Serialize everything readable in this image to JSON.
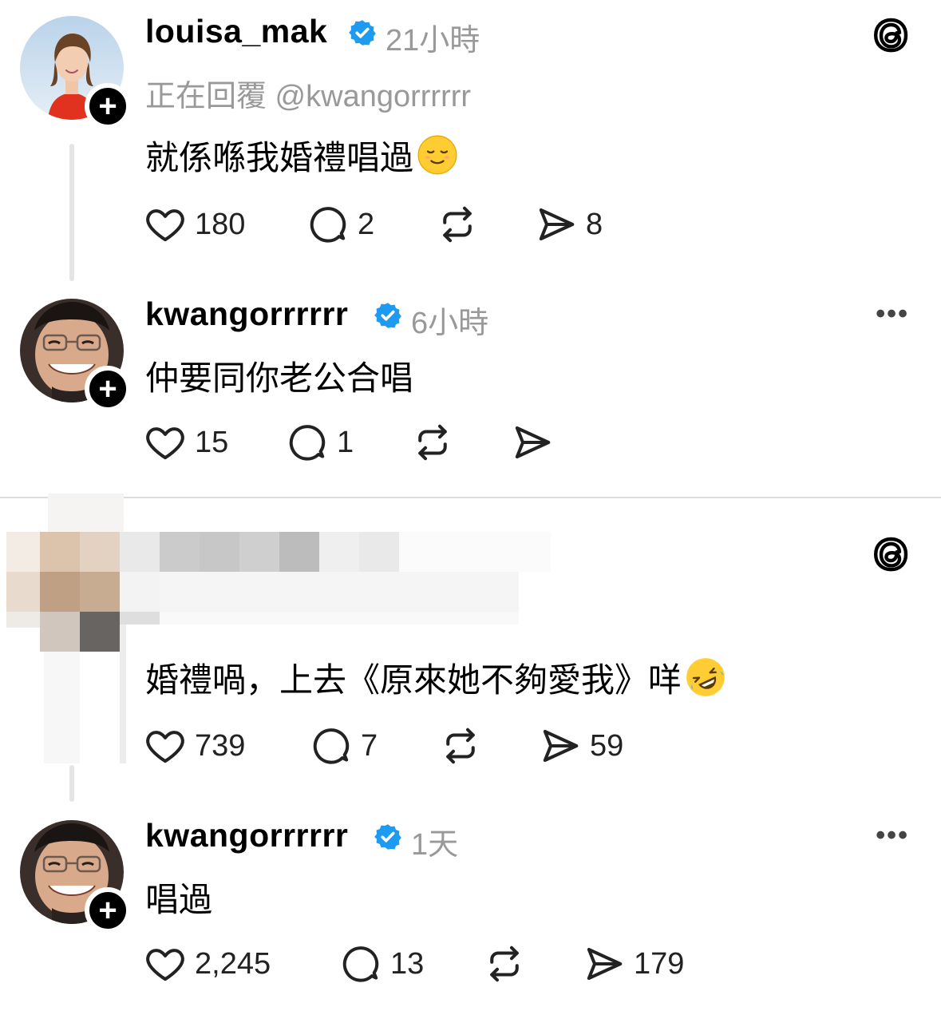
{
  "posts": [
    {
      "username": "louisa_mak",
      "time": "21小時",
      "replying": "正在回覆 @kwangorrrrrr",
      "text": "就係喺我婚禮唱過",
      "likes": "180",
      "comments": "2",
      "reposts": "",
      "shares": "8"
    },
    {
      "username": "kwangorrrrrr",
      "time": "6小時",
      "text": "仲要同你老公合唱",
      "likes": "15",
      "comments": "1",
      "reposts": "",
      "shares": ""
    },
    {
      "username": "",
      "time": "",
      "text": "婚禮喎，上去《原來她不夠愛我》咩",
      "likes": "739",
      "comments": "7",
      "reposts": "",
      "shares": "59"
    },
    {
      "username": "kwangorrrrrr",
      "time": "1天",
      "text": "唱過",
      "likes": "2,245",
      "comments": "13",
      "reposts": "",
      "shares": "179"
    }
  ],
  "icons": {
    "like": "heart-icon",
    "comment": "comment-icon",
    "repost": "repost-icon",
    "share": "share-icon",
    "verified": "verified-badge-icon",
    "threads": "threads-logo-icon",
    "more": "more-options-icon",
    "follow": "follow-plus-icon"
  },
  "colors": {
    "verified": "#1d9bf0",
    "muted": "#999999",
    "text": "#000000"
  }
}
